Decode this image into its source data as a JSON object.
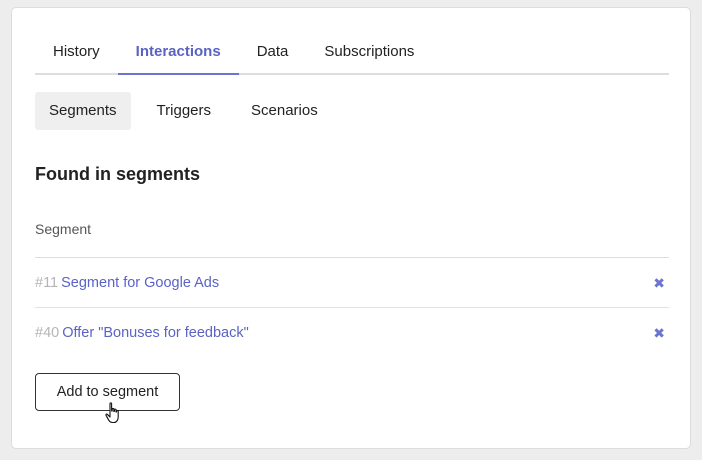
{
  "tabs": [
    {
      "label": "History",
      "active": false
    },
    {
      "label": "Interactions",
      "active": true
    },
    {
      "label": "Data",
      "active": false
    },
    {
      "label": "Subscriptions",
      "active": false
    }
  ],
  "subtabs": [
    {
      "label": "Segments",
      "active": true
    },
    {
      "label": "Triggers",
      "active": false
    },
    {
      "label": "Scenarios",
      "active": false
    }
  ],
  "section": {
    "title": "Found in segments",
    "column_header": "Segment"
  },
  "segments": [
    {
      "id": "#11",
      "name": "Segment for Google Ads"
    },
    {
      "id": "#40",
      "name": "Offer \"Bonuses for feedback\""
    }
  ],
  "actions": {
    "add_label": "Add to segment",
    "remove_glyph": "✖"
  },
  "colors": {
    "accent": "#5a63c4",
    "muted_id": "#b5b5b5",
    "subtab_active_bg": "#efefef"
  }
}
